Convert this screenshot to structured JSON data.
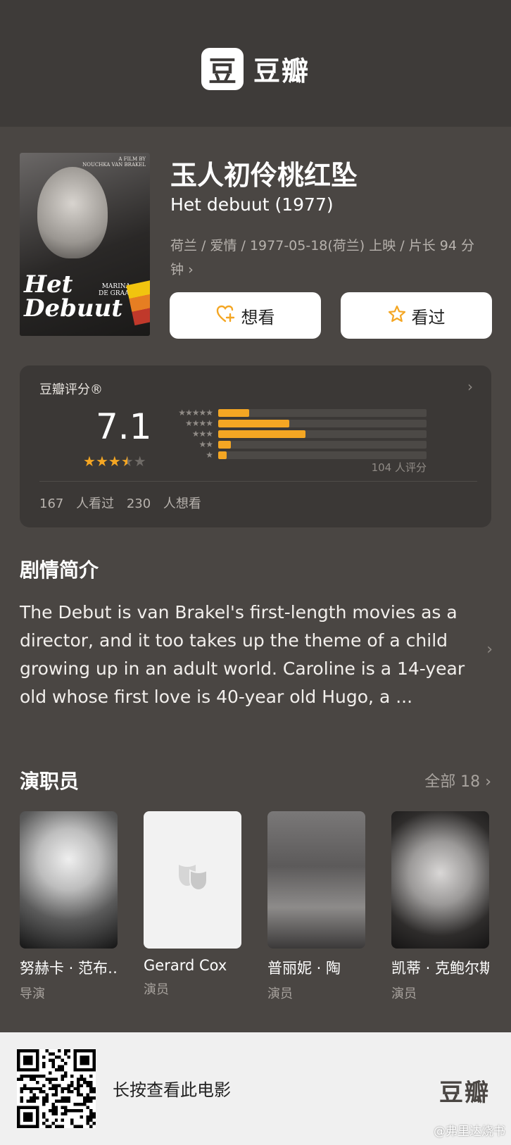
{
  "header": {
    "logo_glyph": "豆",
    "brand": "豆瓣"
  },
  "movie": {
    "title": "玉人初伶桃红坠",
    "original_title": "Het debuut (1977)",
    "meta": "荷兰 / 爱情 / 1977-05-18(荷兰) 上映 / 片长 94 分钟",
    "poster": {
      "credit_line1": "A FILM BY",
      "credit_line2": "NOUCHKA VAN BRAKEL",
      "title_line1": "Het",
      "title_line2": "Debuut",
      "actress_line1": "MARINA",
      "actress_line2": "DE GRAAF"
    }
  },
  "actions": {
    "want_label": "想看",
    "seen_label": "看过",
    "want_icon": "heart-plus-icon",
    "seen_icon": "star-icon"
  },
  "rating": {
    "label": "豆瓣评分®",
    "score": "7.1",
    "stars": 3.5,
    "distribution": [
      {
        "stars": "★★★★★",
        "fraction": 0.15
      },
      {
        "stars": "★★★★",
        "fraction": 0.34
      },
      {
        "stars": "★★★",
        "fraction": 0.42
      },
      {
        "stars": "★★",
        "fraction": 0.06
      },
      {
        "stars": "★",
        "fraction": 0.04
      }
    ],
    "count_text": "104 人评分",
    "watched_text": "167 人看过",
    "wish_text": "230 人想看",
    "accent_color": "#f4a623"
  },
  "synopsis": {
    "title": "剧情简介",
    "text": "The Debut is van Brakel's first-length movies as a director, and it too takes up the theme of a child growing up in an adult world. Caroline is a 14-year old whose first love is 40-year old Hugo, a ..."
  },
  "cast": {
    "title": "演职员",
    "all_label": "全部 18",
    "members": [
      {
        "name": "努赫卡 · 范布…",
        "role": "导演"
      },
      {
        "name": "Gerard Cox",
        "role": "演员"
      },
      {
        "name": "普丽妮 · 陶",
        "role": "演员"
      },
      {
        "name": "凯蒂 · 克鲍尔斯",
        "role": "演员"
      }
    ]
  },
  "footer": {
    "hint": "长按查看此电影",
    "logo": "豆瓣",
    "watermark": "@弗里达烧书"
  }
}
